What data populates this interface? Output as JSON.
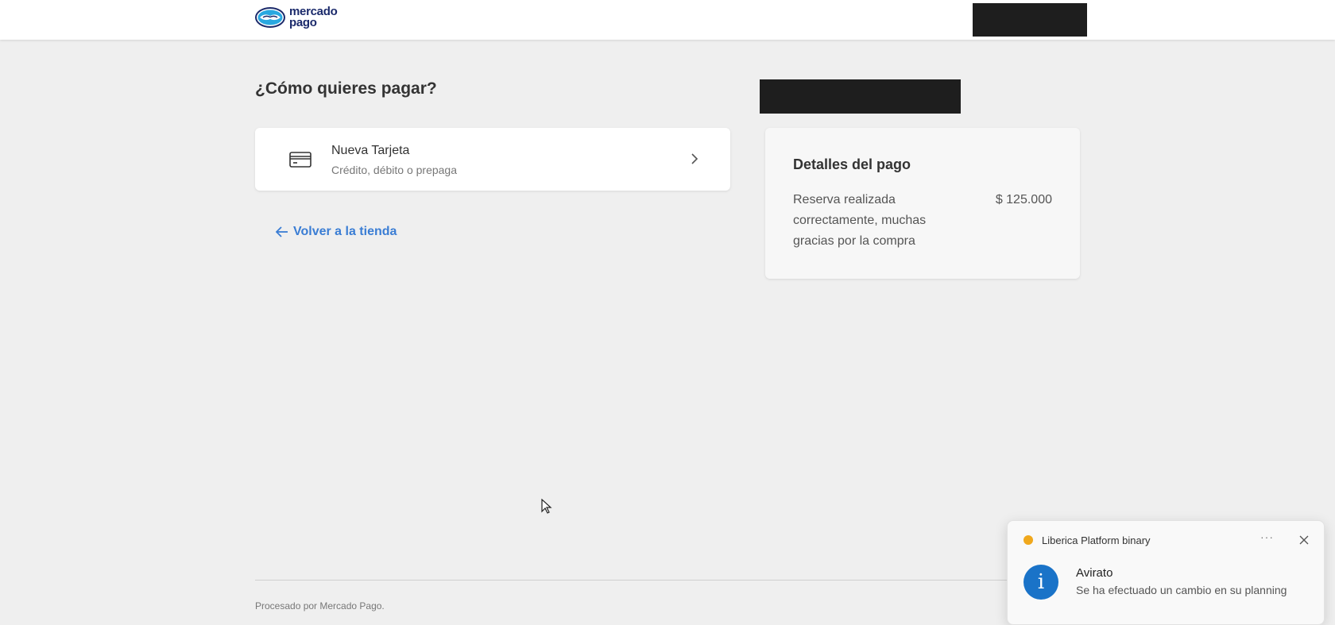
{
  "header": {
    "logo": {
      "line1": "mercado",
      "line2": "pago"
    }
  },
  "main": {
    "title": "¿Cómo quieres pagar?",
    "payment_option": {
      "title": "Nueva Tarjeta",
      "subtitle": "Crédito, débito o prepaga",
      "icon": "credit-card-icon"
    },
    "back_link": "Volver a la tienda"
  },
  "details": {
    "title": "Detalles del pago",
    "description": "Reserva realizada correctamente, muchas gracias por la compra",
    "amount": "$ 125.000"
  },
  "footer": {
    "text": "Procesado por Mercado Pago."
  },
  "notification": {
    "app": "Liberica Platform binary",
    "more": "···",
    "title": "Avirato",
    "message": "Se ha efectuado un cambio en su planning",
    "icon": "info-icon"
  },
  "colors": {
    "link": "#3a7dd4",
    "brand_dark": "#1b2a6b",
    "info_blue": "#1a73c8",
    "background": "#efefef"
  }
}
